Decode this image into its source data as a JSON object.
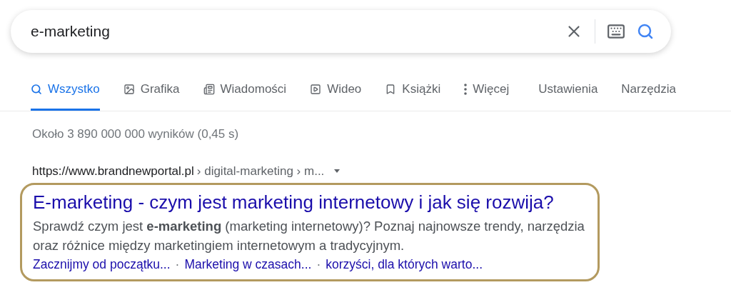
{
  "search": {
    "value": "e-marketing"
  },
  "tabs": [
    {
      "label": "Wszystko",
      "kind": "search",
      "selected": true
    },
    {
      "label": "Grafika",
      "kind": "image",
      "selected": false
    },
    {
      "label": "Wiadomości",
      "kind": "news",
      "selected": false
    },
    {
      "label": "Wideo",
      "kind": "video",
      "selected": false
    },
    {
      "label": "Książki",
      "kind": "book",
      "selected": false
    },
    {
      "label": "Więcej",
      "kind": "more",
      "selected": false
    },
    {
      "label": "Ustawienia",
      "kind": "plain",
      "selected": false
    },
    {
      "label": "Narzędzia",
      "kind": "plain",
      "selected": false
    }
  ],
  "result_stats": "Około 3 890 000 000 wyników (0,45 s)",
  "result": {
    "url": "https://www.brandnewportal.pl",
    "breadcrumb": "› digital-marketing › m...",
    "title": "E-marketing - czym jest marketing internetowy i jak się rozwija?",
    "snippet": "Sprawdź czym jest **e-marketing** (marketing internetowy)? Poznaj najnowsze trendy, narzędzia oraz różnice między marketingiem internetowym a tradycyjnym.",
    "highlighted": true,
    "sitelinks": [
      {
        "kind": "link",
        "text": "Zacznijmy od początku..."
      },
      {
        "kind": "separator",
        "text": "·"
      },
      {
        "kind": "link",
        "text": "Marketing w czasach..."
      },
      {
        "kind": "separator",
        "text": "·"
      },
      {
        "kind": "link",
        "text": "korzyści, dla których warto..."
      }
    ]
  }
}
